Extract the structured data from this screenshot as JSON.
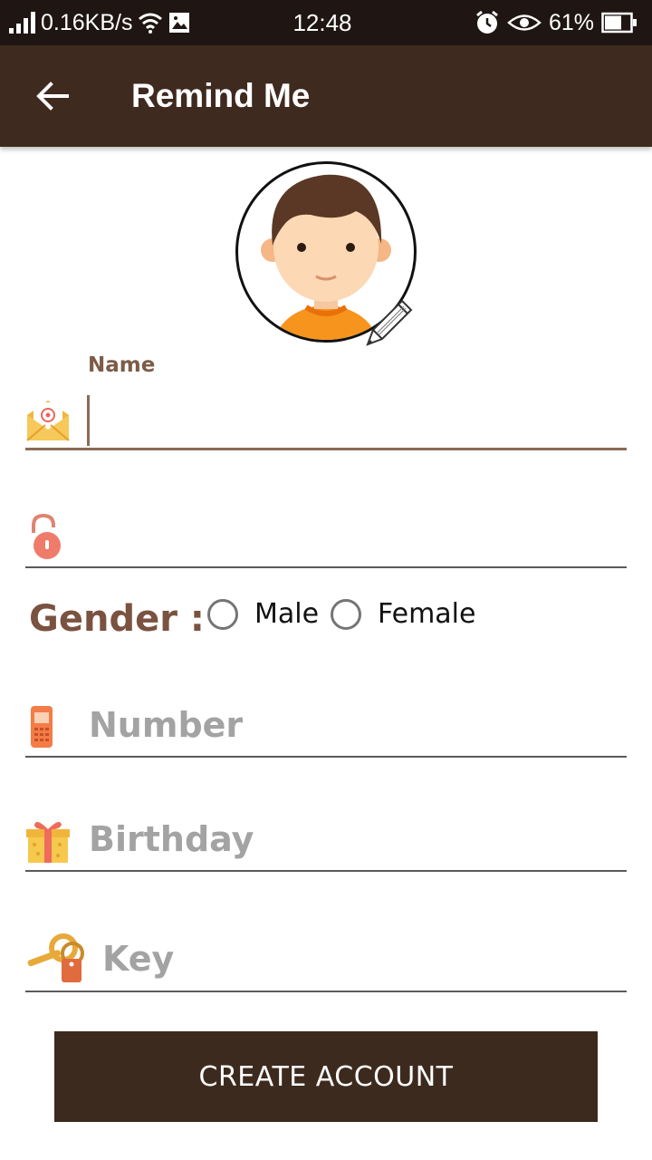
{
  "status_bar": {
    "net_speed": "0.16KB/s",
    "time": "12:48",
    "battery": "61%"
  },
  "app_bar": {
    "title": "Remind Me",
    "back_icon": "arrow-left-icon"
  },
  "form": {
    "name": {
      "label": "Name",
      "value": "",
      "icon": "email-envelope-icon"
    },
    "password": {
      "placeholder": "",
      "icon": "padlock-icon"
    },
    "gender": {
      "label": "Gender :",
      "options": [
        "Male",
        "Female"
      ],
      "selected": null
    },
    "number": {
      "placeholder": "Number",
      "icon": "mobile-phone-icon"
    },
    "birthday": {
      "placeholder": "Birthday",
      "icon": "gift-icon"
    },
    "key": {
      "placeholder": "Key",
      "icon": "key-tag-icon"
    }
  },
  "actions": {
    "create_label": "CREATE ACCOUNT"
  },
  "colors": {
    "app_bar": "#3f2a1f",
    "status_bar": "#1f1613",
    "accent": "#8b6b55",
    "button": "#3d2a1e"
  }
}
